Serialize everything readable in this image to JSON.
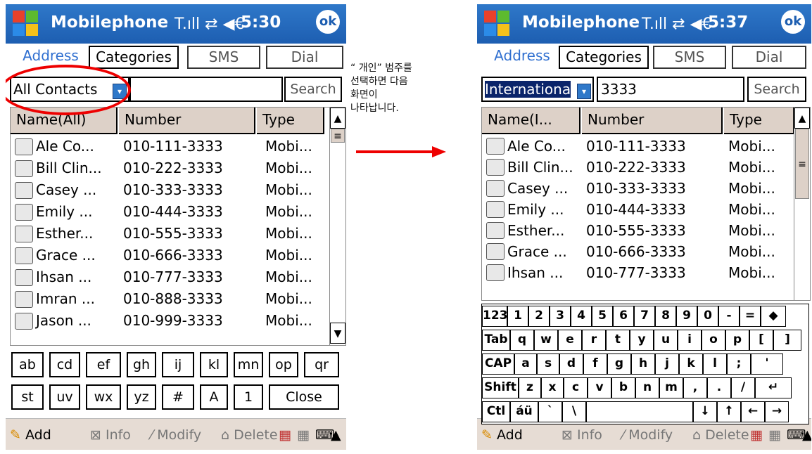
{
  "colors": {
    "title_bar": "#1d5eb1",
    "tab_active": "#2f6fd0",
    "header_bg": "#ddd1c8",
    "annotation": "#e00000"
  },
  "left": {
    "title": "Mobilephone",
    "signal": "T.ıll ⇄ ◀€",
    "time": "5:30",
    "ok": "ok",
    "tabs": [
      "Address",
      "Categories",
      "SMS",
      "Dial"
    ],
    "filter": "All Contacts",
    "search_value": "",
    "search_label": "Search",
    "columns": [
      "Name(All)",
      "Number",
      "Type"
    ],
    "rows": [
      {
        "name": "Ale Co...",
        "number": "010-111-3333",
        "type": "Mobi..."
      },
      {
        "name": "Bill Clin...",
        "number": "010-222-3333",
        "type": "Mobi..."
      },
      {
        "name": "Casey ...",
        "number": "010-333-3333",
        "type": "Mobi..."
      },
      {
        "name": "Emily ...",
        "number": "010-444-3333",
        "type": "Mobi..."
      },
      {
        "name": "Esther...",
        "number": "010-555-3333",
        "type": "Mobi..."
      },
      {
        "name": "Grace ...",
        "number": "010-666-3333",
        "type": "Mobi..."
      },
      {
        "name": "Ihsan ...",
        "number": "010-777-3333",
        "type": "Mobi..."
      },
      {
        "name": "Imran ...",
        "number": "010-888-3333",
        "type": "Mobi..."
      },
      {
        "name": "Jason ...",
        "number": "010-999-3333",
        "type": "Mobi..."
      }
    ],
    "alpha_row1": [
      "ab",
      "cd",
      "ef",
      "gh",
      "ij",
      "kl",
      "mn",
      "op",
      "qr"
    ],
    "alpha_row2": [
      "st",
      "uv",
      "wx",
      "yz",
      "#",
      "A",
      "1",
      "Close"
    ],
    "toolbar": {
      "add": "Add",
      "info": "Info",
      "modify": "Modify",
      "delete": "Delete"
    }
  },
  "right": {
    "title": "Mobilephone",
    "signal": "T.ıll ⇄ ◀€",
    "time": "5:37",
    "ok": "ok",
    "tabs": [
      "Address",
      "Categories",
      "SMS",
      "Dial"
    ],
    "filter": "Internationa",
    "search_value": "3333",
    "search_label": "Search",
    "columns": [
      "Name(I...",
      "Number",
      "Type"
    ],
    "rows": [
      {
        "name": "Ale Co...",
        "number": "010-111-3333",
        "type": "Mobi..."
      },
      {
        "name": "Bill Clin...",
        "number": "010-222-3333",
        "type": "Mobi..."
      },
      {
        "name": "Casey ...",
        "number": "010-333-3333",
        "type": "Mobi..."
      },
      {
        "name": "Emily ...",
        "number": "010-444-3333",
        "type": "Mobi..."
      },
      {
        "name": "Esther...",
        "number": "010-555-3333",
        "type": "Mobi..."
      },
      {
        "name": "Grace ...",
        "number": "010-666-3333",
        "type": "Mobi..."
      },
      {
        "name": "Ihsan ...",
        "number": "010-777-3333",
        "type": "Mobi..."
      }
    ],
    "keyboard": [
      [
        "123",
        "1",
        "2",
        "3",
        "4",
        "5",
        "6",
        "7",
        "8",
        "9",
        "0",
        "-",
        "=",
        "◆"
      ],
      [
        "Tab",
        "q",
        "w",
        "e",
        "r",
        "t",
        "y",
        "u",
        "i",
        "o",
        "p",
        "[",
        "]"
      ],
      [
        "CAP",
        "a",
        "s",
        "d",
        "f",
        "g",
        "h",
        "j",
        "k",
        "l",
        ";",
        "'"
      ],
      [
        "Shift",
        "z",
        "x",
        "c",
        "v",
        "b",
        "n",
        "m",
        ",",
        ".",
        "/",
        "↵"
      ],
      [
        "Ctl",
        "áü",
        "`",
        "\\",
        "",
        "↓",
        "↑",
        "←",
        "→"
      ]
    ],
    "toolbar": {
      "add": "Add",
      "info": "Info",
      "modify": "Modify",
      "delete": "Delete"
    }
  },
  "annotation": {
    "lines": [
      "“ 개인”  범주를",
      "선택하면  다음",
      "화면이",
      "나타납니다."
    ]
  }
}
